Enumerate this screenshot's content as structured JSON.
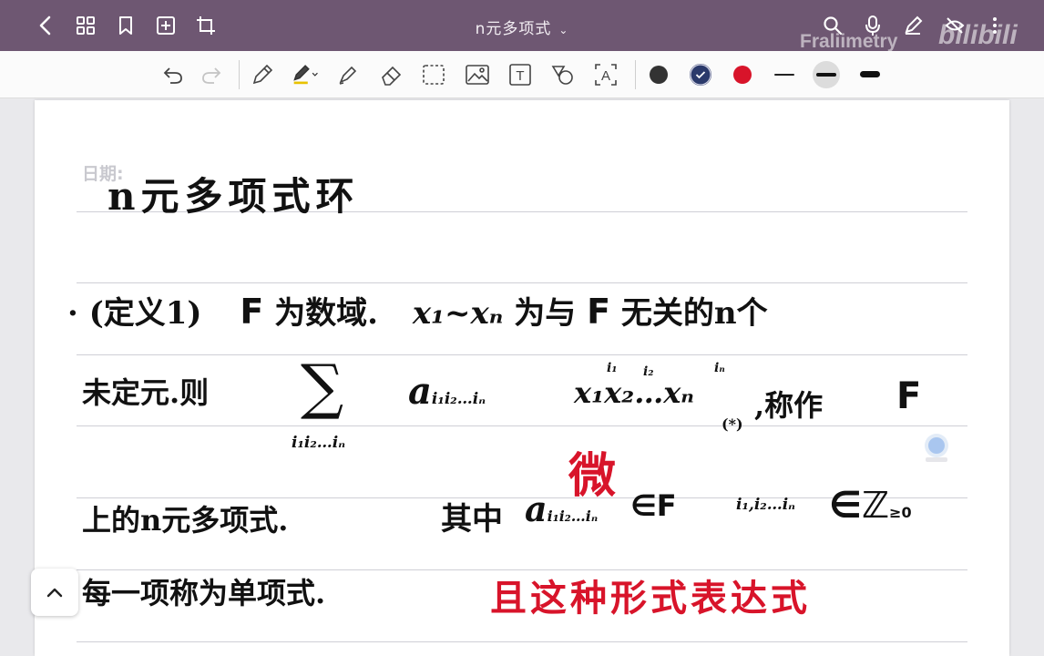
{
  "top_bar": {
    "title": "n元多项式",
    "title_caret": "⌄",
    "watermark": "Fraliimetry",
    "watermark2": "bilibili"
  },
  "toolbar": {
    "colors": [
      "#333333",
      "#2b3a6b",
      "#d8142a"
    ],
    "text_tool_label": "T",
    "ocr_tool_label": "A"
  },
  "page": {
    "date_label": "日期:",
    "title": "n元多项式环",
    "line1": {
      "bullet": "·",
      "paren": "(定义1)",
      "field": "F",
      "text_a": "为数域.",
      "vars": "x₁~xₙ",
      "text_b": "为与",
      "field2": "F",
      "text_c": "无关的n个"
    },
    "line2": {
      "text_a": "未定元.则",
      "sum": "∑",
      "sum_index": "i₁i₂…iₙ",
      "coef": "a",
      "coef_sub": "i₁i₂…iₙ",
      "monomial": "x₁x₂…xₙ",
      "sup1": "i₁",
      "sup2": "i₂",
      "sup3": "iₙ",
      "star": "(*)",
      "text_b": ",称作",
      "field": "F"
    },
    "red_note_1": "微",
    "line3": {
      "text_a": "上的n元多项式.",
      "text_b": "其中",
      "coef": "a",
      "coef_sub": "i₁i₂…iₙ",
      "in_field": "∈F",
      "indices": "i₁,i₂…iₙ",
      "in_z": "∈ℤ",
      "z_sub": "≥0"
    },
    "line4": {
      "text_a": "每一项称为单项式.",
      "red_text": "且这种形式表达式"
    }
  }
}
